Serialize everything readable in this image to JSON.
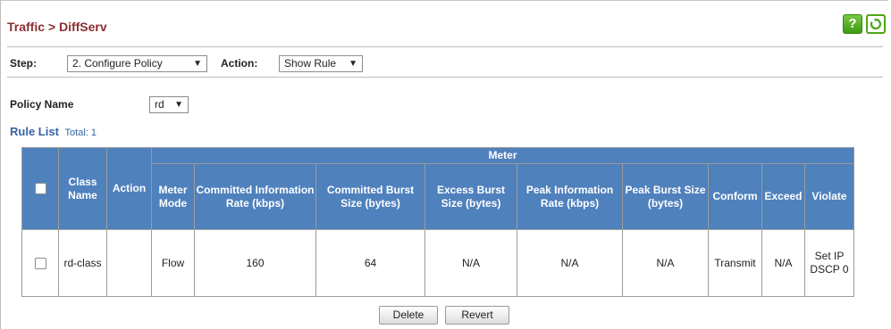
{
  "header": {
    "title": "Traffic > DiffServ",
    "help_label": "?"
  },
  "step": {
    "label": "Step:",
    "value": "2. Configure Policy",
    "action_label": "Action:",
    "action_value": "Show Rule"
  },
  "policy": {
    "label": "Policy Name",
    "value": "rd"
  },
  "rule_list": {
    "title": "Rule List",
    "total": "Total: 1"
  },
  "table": {
    "headers": {
      "class_name": "Class Name",
      "action": "Action",
      "meter": "Meter",
      "meter_mode": "Meter Mode",
      "cir": "Committed Information Rate (kbps)",
      "cbs": "Committed Burst Size (bytes)",
      "ebs": "Excess Burst Size (bytes)",
      "pir": "Peak Information Rate (kbps)",
      "pbs": "Peak Burst Size (bytes)",
      "conform": "Conform",
      "exceed": "Exceed",
      "violate": "Violate"
    },
    "rows": [
      {
        "class_name": "rd-class",
        "action": "",
        "meter_mode": "Flow",
        "cir": "160",
        "cbs": "64",
        "ebs": "N/A",
        "pir": "N/A",
        "pbs": "N/A",
        "conform": "Transmit",
        "exceed": "N/A",
        "violate": "Set IP DSCP 0"
      }
    ]
  },
  "buttons": {
    "delete": "Delete",
    "revert": "Revert"
  },
  "colors": {
    "title": "#8b2f2f",
    "header_bg": "#4f81bd",
    "accent": "#3465a4",
    "help_green": "#4ea519"
  }
}
